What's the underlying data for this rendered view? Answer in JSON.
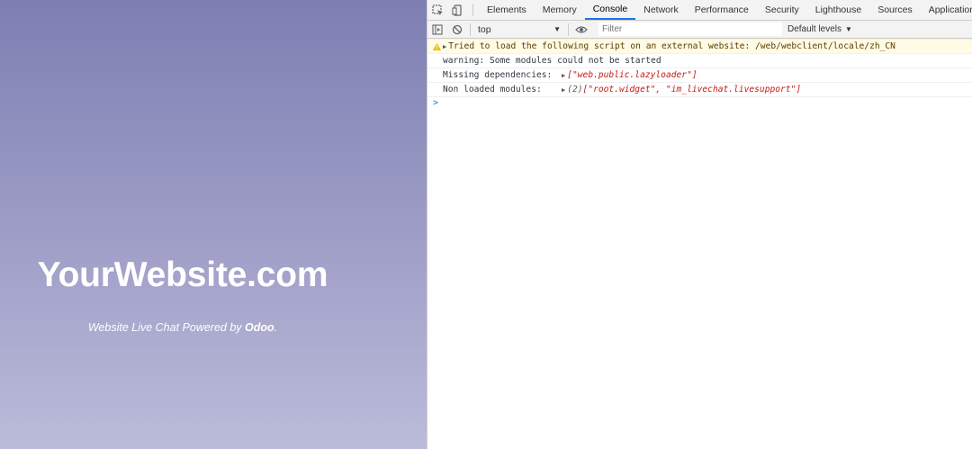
{
  "site": {
    "title": "YourWebsite.com",
    "subtitle_prefix": "Website Live Chat Powered by ",
    "subtitle_brand": "Odoo",
    "subtitle_suffix": "."
  },
  "devtools": {
    "tabs": [
      {
        "label": "Elements"
      },
      {
        "label": "Memory"
      },
      {
        "label": "Console"
      },
      {
        "label": "Network"
      },
      {
        "label": "Performance"
      },
      {
        "label": "Security"
      },
      {
        "label": "Lighthouse"
      },
      {
        "label": "Sources"
      },
      {
        "label": "Application"
      }
    ],
    "active_tab": "Console",
    "toolbar": {
      "context": "top",
      "filter_placeholder": "Filter",
      "levels": "Default levels"
    },
    "console": {
      "warning": "Tried to load the following script on an external website: /web/webclient/locale/zh_CN",
      "line2": "warning: Some modules could not be started",
      "missing_label": "Missing dependencies:",
      "missing_value": "[\"web.public.lazyloader\"]",
      "nonloaded_label": "Non loaded modules:",
      "nonloaded_count": "(2) ",
      "nonloaded_value": "[\"root.widget\", \"im_livechat.livesupport\"]",
      "prompt": ">"
    }
  },
  "colors": {
    "accent": "#1a73e8",
    "warning_bg": "#fffbe5",
    "string_red": "#c41a16"
  }
}
